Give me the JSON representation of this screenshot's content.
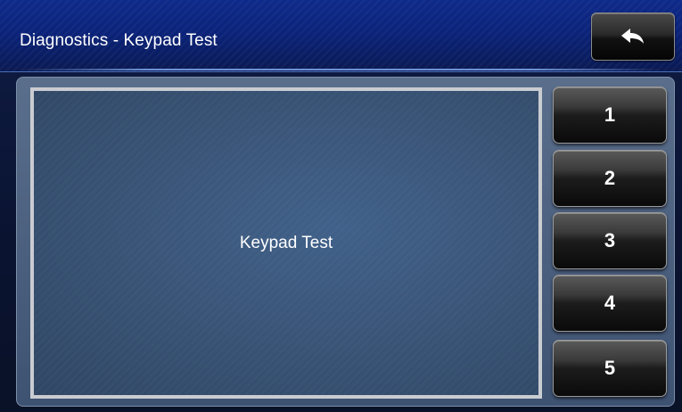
{
  "header": {
    "title": "Diagnostics - Keypad Test",
    "back_icon": "back-arrow-icon"
  },
  "main": {
    "test_area_label": "Keypad Test"
  },
  "keypad": {
    "buttons": [
      {
        "label": "1"
      },
      {
        "label": "2"
      },
      {
        "label": "3"
      },
      {
        "label": "4"
      },
      {
        "label": "5"
      }
    ]
  },
  "colors": {
    "header_blue": "#0e2a8a",
    "panel_blue": "#3a5578",
    "button_black": "#0a0a0a",
    "text_white": "#ffffff"
  }
}
